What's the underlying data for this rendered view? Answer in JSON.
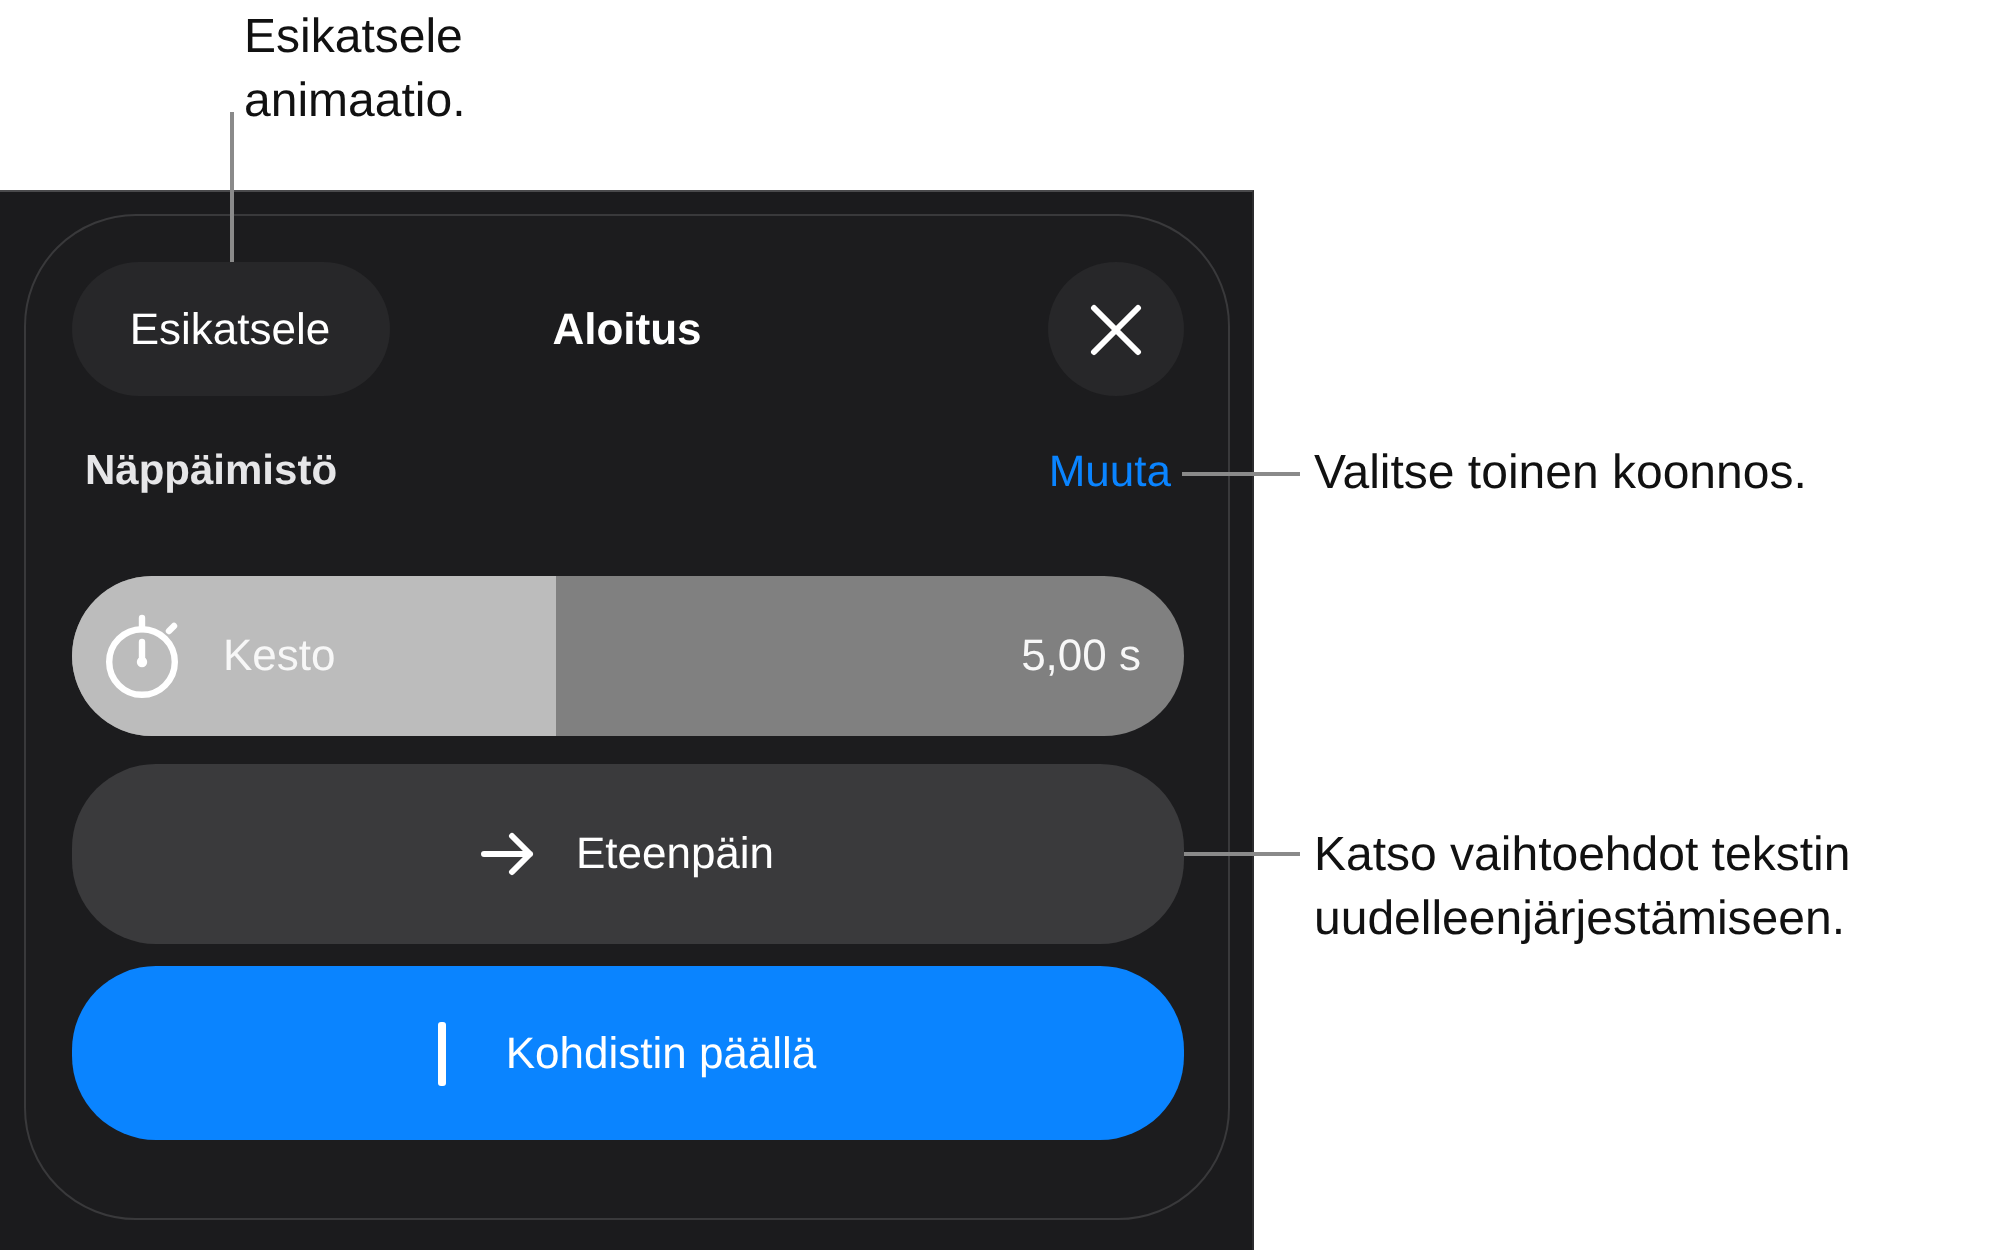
{
  "callouts": [
    {
      "text": "Esikatsele animaatio."
    },
    {
      "text": "Valitse toinen koonnos."
    },
    {
      "text": "Katso vaihtoehdot tekstin uudelleenjärjestämiseen."
    }
  ],
  "panel": {
    "preview_button": "Esikatsele",
    "title": "Aloitus",
    "section_label": "Näppäimistö",
    "change_link": "Muuta",
    "duration": {
      "label": "Kesto",
      "reading": "5,00 s",
      "level": 0.436
    },
    "direction_button": {
      "label": "Eteenpäin"
    },
    "cursor_button": {
      "label": "Kohdistin päällä",
      "on": true
    }
  }
}
